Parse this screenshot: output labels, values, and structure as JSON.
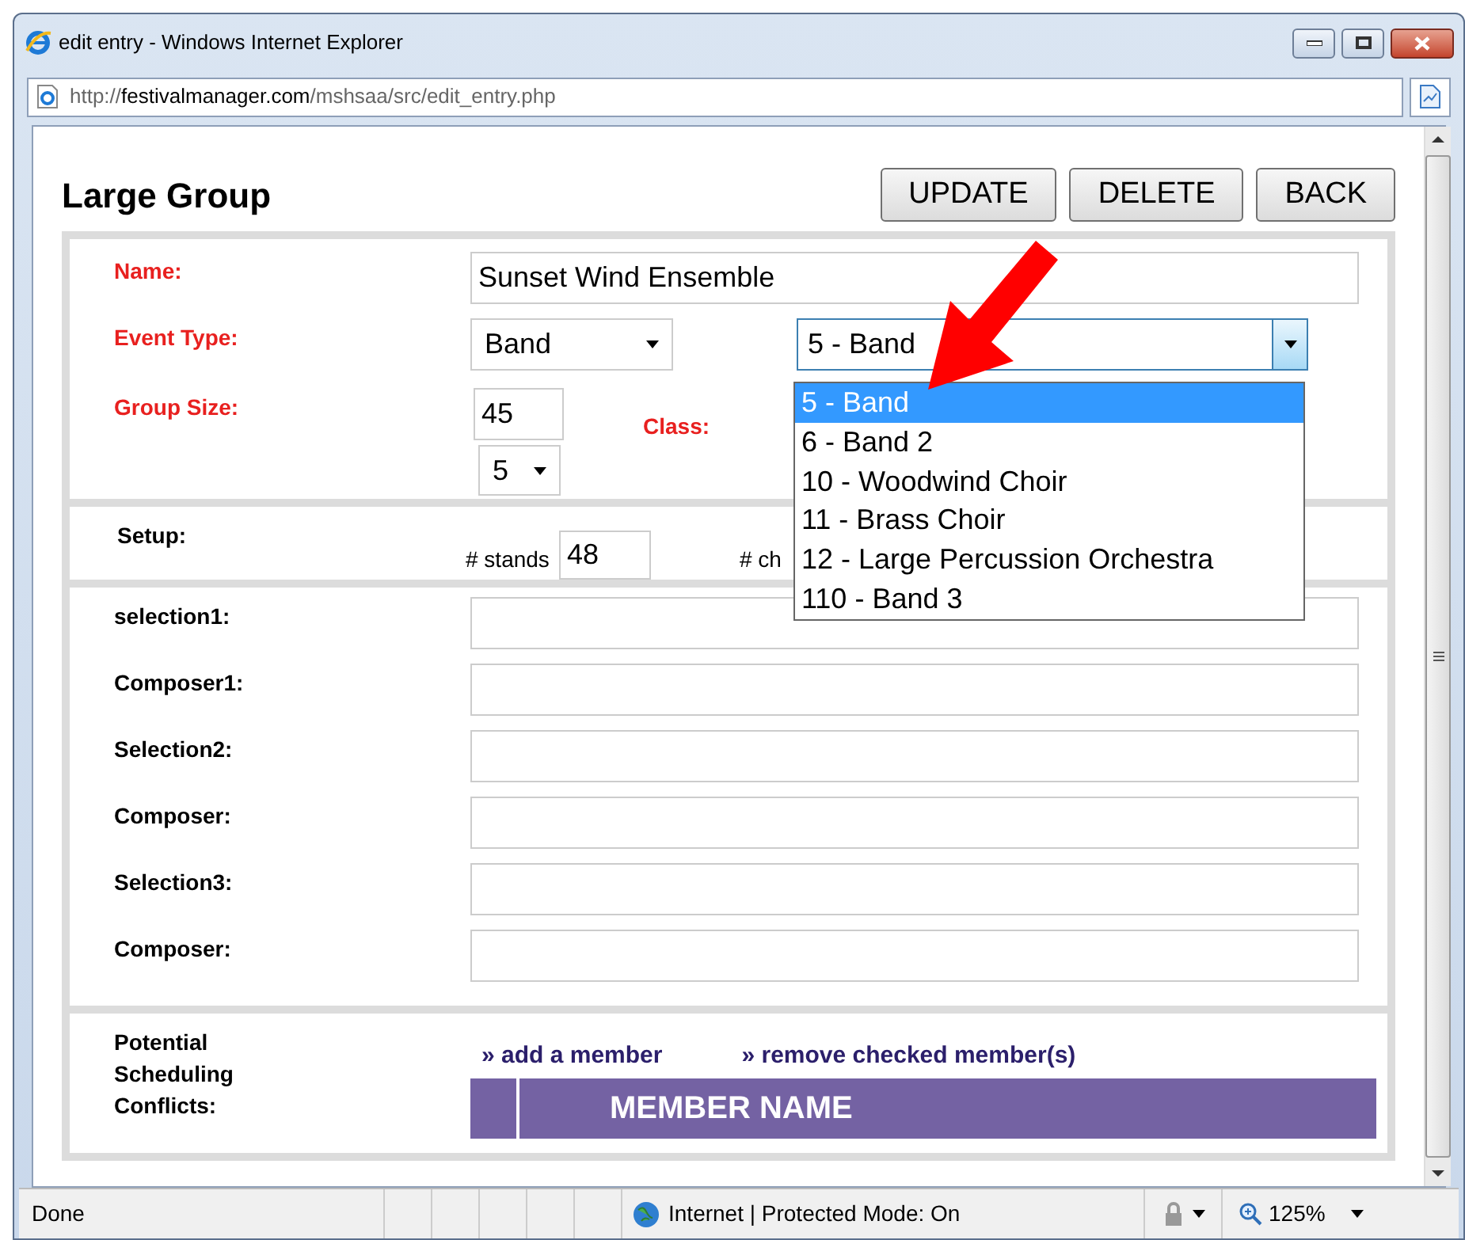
{
  "window": {
    "title": "edit entry - Windows Internet Explorer"
  },
  "address": {
    "scheme": "http://",
    "domain": "festivalmanager.com",
    "path": "/mshsaa/src/edit_entry.php"
  },
  "page": {
    "heading": "Large Group",
    "buttons": [
      "UPDATE",
      "DELETE",
      "BACK"
    ]
  },
  "form": {
    "name": {
      "label": "Name:",
      "value": "Sunset Wind Ensemble"
    },
    "event_type": {
      "label": "Event Type:",
      "value": "Band",
      "division_value": "5 - Band",
      "expanded": true,
      "options": [
        {
          "label": "5 - Band",
          "selected": true
        },
        {
          "label": "6 - Band 2",
          "selected": false
        },
        {
          "label": "10 - Woodwind Choir",
          "selected": false
        },
        {
          "label": "11 - Brass Choir",
          "selected": false
        },
        {
          "label": "12 - Large Percussion Orchestra",
          "selected": false
        },
        {
          "label": "110 - Band 3",
          "selected": false
        }
      ]
    },
    "group_size": {
      "label": "Group Size:",
      "value": "45"
    },
    "class": {
      "label": "Class:",
      "value": "5"
    },
    "setup": {
      "label": "Setup:",
      "stands_label": "# stands",
      "stands_value": "48",
      "chairs_label": "# ch"
    },
    "repertoire": [
      {
        "label": "selection1:"
      },
      {
        "label": "Composer1:"
      },
      {
        "label": "Selection2:"
      },
      {
        "label": "Composer:"
      },
      {
        "label": "Selection3:"
      },
      {
        "label": "Composer:"
      }
    ],
    "conflicts": {
      "label": "Potential Scheduling Conflicts:",
      "links": [
        "» add a member",
        "» remove checked member(s)"
      ],
      "column_header": "MEMBER NAME"
    }
  },
  "status_bar": {
    "text": "Done",
    "zone": "Internet | Protected Mode: On",
    "zoom": "125%"
  }
}
